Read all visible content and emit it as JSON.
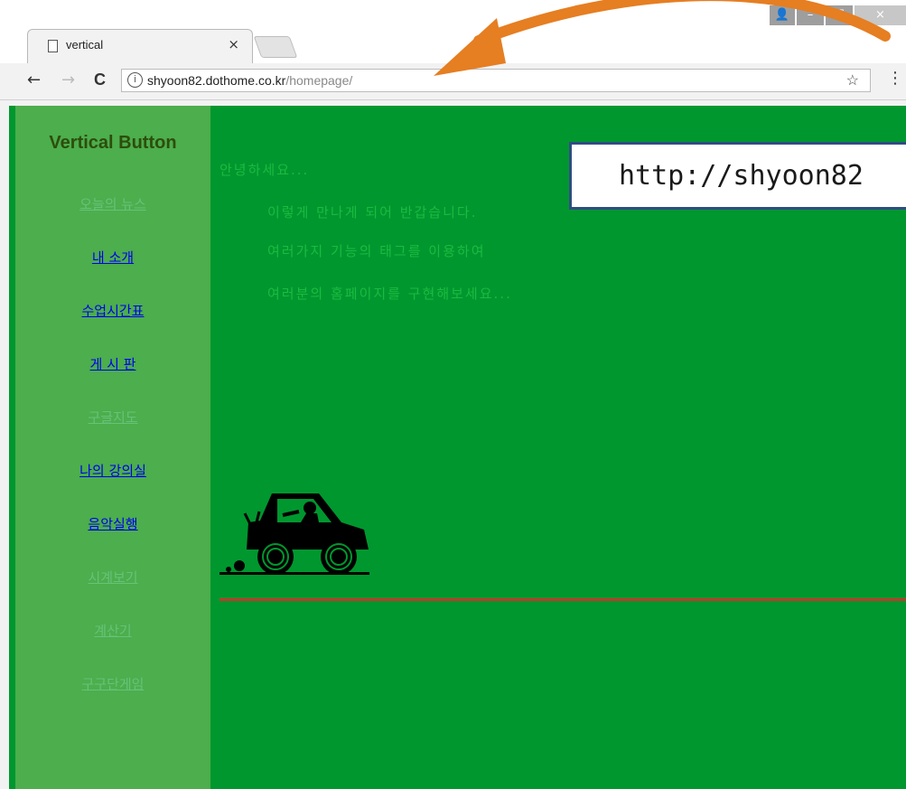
{
  "browser": {
    "tab_title": "vertical",
    "tab_close": "×",
    "url_host": "shyoon82.dothome.co.kr",
    "url_path": "/homepage/",
    "info_glyph": "ⓘ",
    "star_glyph": "☆",
    "menu_glyph": "⋮",
    "back_glyph": "←",
    "forward_glyph": "→",
    "reload_glyph": "C",
    "min_glyph": "–",
    "max_glyph": "☐",
    "close_glyph": "×",
    "user_glyph": "👤"
  },
  "sidebar": {
    "heading": "Vertical Button",
    "items": [
      {
        "label": "오늘의 뉴스",
        "style": "faint"
      },
      {
        "label": "내 소개",
        "style": "blue"
      },
      {
        "label": "수업시간표",
        "style": "blue"
      },
      {
        "label": "게 시 판",
        "style": "blue"
      },
      {
        "label": "구글지도",
        "style": "faint"
      },
      {
        "label": "나의 강의실",
        "style": "blue"
      },
      {
        "label": "음악실행",
        "style": "blue"
      },
      {
        "label": "시계보기",
        "style": "faint"
      },
      {
        "label": "계산기",
        "style": "faint"
      },
      {
        "label": "구구단게임",
        "style": "faint"
      }
    ]
  },
  "content": {
    "lines": [
      "안녕하세요...",
      "이렇게 만나게 되어 반갑습니다.",
      "여러가지 기능의 태그를 이용하여",
      "여러분의 홈페이지를 구현해보세요..."
    ],
    "overlay_url": "http://shyoon82"
  },
  "colors": {
    "page_bg": "#00972f",
    "sidebar_bg": "#4cae4c",
    "link_blue": "#0000ee",
    "divider_red": "#c0392b",
    "annotation_arrow": "#e67e22"
  }
}
